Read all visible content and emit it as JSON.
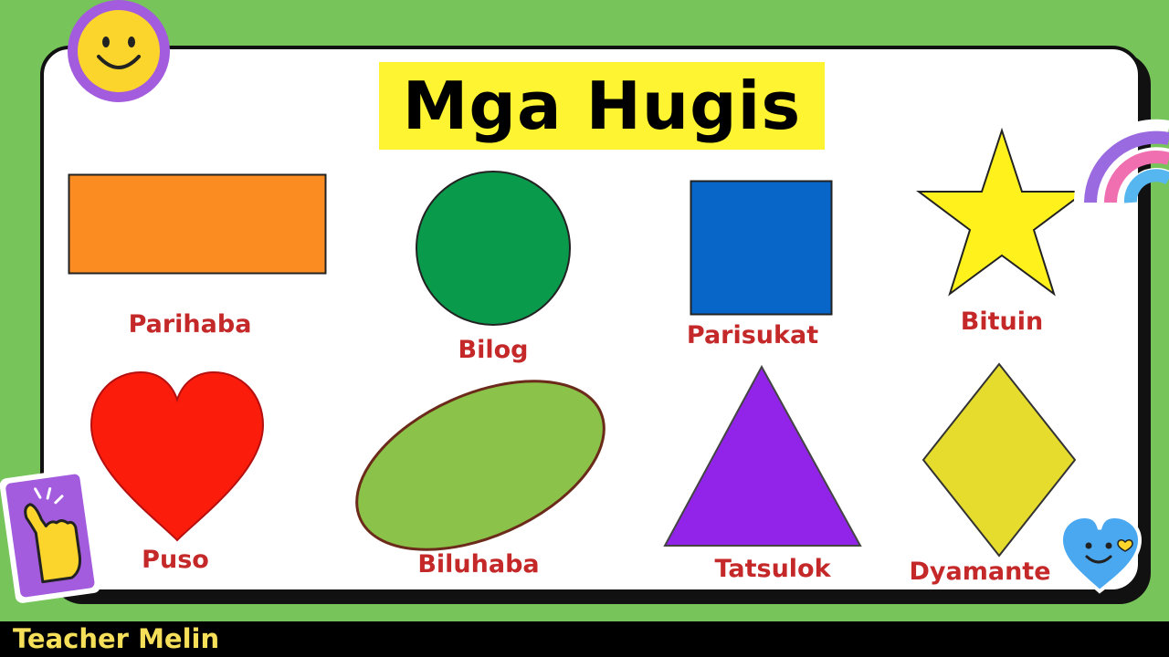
{
  "title": "Mga Hugis",
  "footer": {
    "channel": "Teacher Melin"
  },
  "shapes": [
    {
      "label": "Parihaba",
      "color": "#fb8c22",
      "icon": "rectangle-shape"
    },
    {
      "label": "Bilog",
      "color": "#0a9a4c",
      "icon": "circle-shape"
    },
    {
      "label": "Parisukat",
      "color": "#0866c9",
      "icon": "square-shape"
    },
    {
      "label": "Bituin",
      "color": "#fff21c",
      "icon": "star-shape"
    },
    {
      "label": "Puso",
      "color": "#fb1c0c",
      "icon": "heart-shape"
    },
    {
      "label": "Biluhaba",
      "color": "#8bc24a",
      "icon": "oval-shape"
    },
    {
      "label": "Tatsulok",
      "color": "#9124e8",
      "icon": "triangle-shape"
    },
    {
      "label": "Dyamante",
      "color": "#e6dc2e",
      "icon": "diamond-shape"
    }
  ],
  "colors": {
    "background": "#77c55a",
    "label": "#c42828",
    "title_highlight": "#fff432",
    "footer_text": "#f6e05a"
  },
  "decorations": [
    "smiley-face-icon",
    "rainbow-icon",
    "pointing-hand-icon",
    "heart-face-icon"
  ]
}
